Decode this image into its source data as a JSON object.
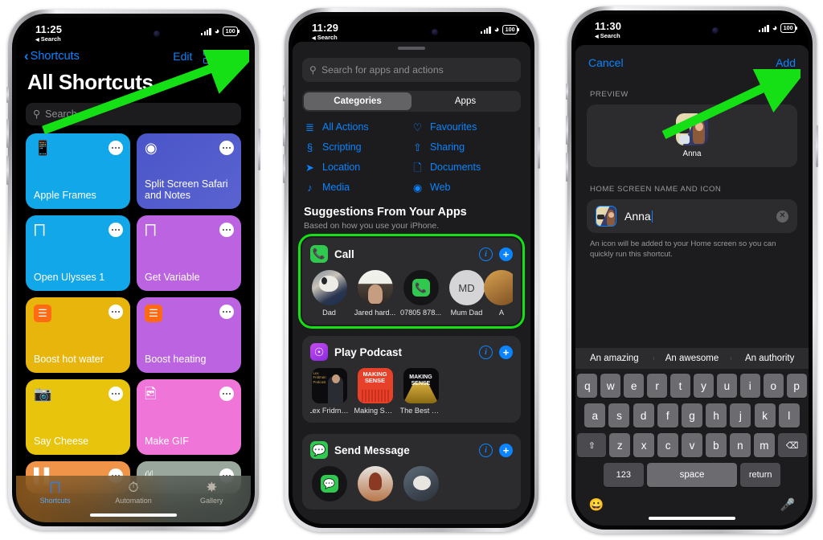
{
  "phones": [
    {
      "id": "shortcuts-list",
      "status": {
        "time": "11:25",
        "back_app": "Search",
        "battery": "100",
        "wifi_icon": "wifi-icon",
        "signal_icon": "cellular-signal-icon"
      },
      "nav": {
        "back_label": "Shortcuts",
        "edit_label": "Edit",
        "grid_icon": "grid-view-icon",
        "add_icon": "plus-icon"
      },
      "title": "All Shortcuts",
      "search": {
        "placeholder": "Search",
        "icon": "search-icon"
      },
      "shortcuts": [
        {
          "name": "Apple Frames",
          "color": "#12a7e8",
          "glyph": "📱",
          "icon_name": "iphone-icon",
          "menu_icon": "ellipsis-icon"
        },
        {
          "name": "Split Screen Safari and Notes",
          "color": "#4a55c8",
          "glyph": "◎",
          "icon_name": "safari-compass-icon",
          "menu_icon": "ellipsis-icon"
        },
        {
          "name": "Open Ulysses 1",
          "color": "#12a7e8",
          "glyph": "≣",
          "icon_name": "layers-icon",
          "menu_icon": "ellipsis-icon"
        },
        {
          "name": "Get Variable",
          "color": "#bb63e0",
          "glyph": "≣",
          "icon_name": "layers-icon",
          "menu_icon": "ellipsis-icon"
        },
        {
          "name": "Boost hot water",
          "color": "#e8b50c",
          "glyph": "☰",
          "icon_name": "home-radiator-icon",
          "menu_icon": "ellipsis-icon"
        },
        {
          "name": "Boost heating",
          "color": "#bb63e0",
          "glyph": "☰",
          "icon_name": "home-radiator-icon",
          "menu_icon": "ellipsis-icon"
        },
        {
          "name": "Say Cheese",
          "color": "#e8c50c",
          "glyph": "📷",
          "icon_name": "camera-icon",
          "menu_icon": "ellipsis-icon"
        },
        {
          "name": "Make GIF",
          "color": "#ef76d8",
          "glyph": "🖼",
          "icon_name": "photos-stack-icon",
          "menu_icon": "ellipsis-icon"
        },
        {
          "name": "",
          "color": "#f0944a",
          "glyph": "▐▌",
          "icon_name": "books-icon",
          "menu_icon": "ellipsis-icon"
        },
        {
          "name": "",
          "color": "#9aa79c",
          "glyph": "⚇",
          "icon_name": "airpods-icon",
          "menu_icon": "ellipsis-icon"
        }
      ],
      "tabs": [
        {
          "label": "Shortcuts",
          "icon_name": "layers-icon",
          "glyph": "≣",
          "active": true
        },
        {
          "label": "Automation",
          "icon_name": "clock-automation-icon",
          "glyph": "⏱",
          "active": false
        },
        {
          "label": "Gallery",
          "icon_name": "gallery-sparkle-icon",
          "glyph": "✨",
          "active": false
        }
      ],
      "annotation": {
        "type": "arrow",
        "color": "#15e015",
        "target": "plus-icon"
      }
    },
    {
      "id": "action-picker",
      "status": {
        "time": "11:29",
        "back_app": "Search",
        "battery": "100",
        "wifi_icon": "wifi-icon",
        "signal_icon": "cellular-signal-icon"
      },
      "search": {
        "placeholder": "Search for apps and actions",
        "icon": "search-icon"
      },
      "segments": [
        {
          "label": "Categories",
          "selected": true
        },
        {
          "label": "Apps",
          "selected": false
        }
      ],
      "categories": [
        {
          "label": "All Actions",
          "icon_name": "list-bullet-icon",
          "glyph": "☰"
        },
        {
          "label": "Favourites",
          "icon_name": "heart-icon",
          "glyph": "♡"
        },
        {
          "label": "Scripting",
          "icon_name": "scripting-icon",
          "glyph": "§"
        },
        {
          "label": "Sharing",
          "icon_name": "share-icon",
          "glyph": "⇧"
        },
        {
          "label": "Location",
          "icon_name": "location-arrow-icon",
          "glyph": "➤"
        },
        {
          "label": "Documents",
          "icon_name": "document-icon",
          "glyph": "☐"
        },
        {
          "label": "Media",
          "icon_name": "music-note-icon",
          "glyph": "♪"
        },
        {
          "label": "Web",
          "icon_name": "safari-compass-icon",
          "glyph": "◎"
        }
      ],
      "suggestions_header": "Suggestions From Your Apps",
      "suggestions_sub": "Based on how you use your iPhone.",
      "suggestions": [
        {
          "title": "Call",
          "app_icon_name": "phone-app-icon",
          "app_glyph": "📞",
          "app_color": "#30c94f",
          "info_icon": "info-icon",
          "add_icon": "plus-circle-icon",
          "highlighted": true,
          "items": [
            {
              "label": "Dad",
              "kind": "photo-dog"
            },
            {
              "label": "Jared hard...",
              "kind": "photo-person"
            },
            {
              "label": "07805 878...",
              "kind": "phone-glyph"
            },
            {
              "label": "Mum Dad",
              "kind": "initials",
              "initials": "MD"
            },
            {
              "label": "A",
              "kind": "photo-cut"
            }
          ]
        },
        {
          "title": "Play Podcast",
          "app_icon_name": "podcasts-app-icon",
          "app_glyph": "ⓟ",
          "app_color": "#9b3ce0",
          "info_icon": "info-icon",
          "add_icon": "plus-circle-icon",
          "highlighted": false,
          "items": [
            {
              "label": "Lex Fridma...",
              "kind": "art-lex"
            },
            {
              "label": "Making Sen...",
              "kind": "art-making-red"
            },
            {
              "label": "The Best of...",
              "kind": "art-making-black"
            }
          ]
        },
        {
          "title": "Send Message",
          "app_icon_name": "messages-app-icon",
          "app_glyph": "💬",
          "app_color": "#30c94f",
          "info_icon": "info-icon",
          "add_icon": "plus-circle-icon",
          "highlighted": false,
          "items": [
            {
              "label": "",
              "kind": "msg-glyph"
            },
            {
              "label": "",
              "kind": "photo-woman"
            },
            {
              "label": "",
              "kind": "photo-dog"
            }
          ]
        }
      ]
    },
    {
      "id": "add-to-home-screen",
      "status": {
        "time": "11:30",
        "back_app": "Search",
        "battery": "100",
        "wifi_icon": "wifi-icon",
        "signal_icon": "cellular-signal-icon"
      },
      "nav": {
        "cancel_label": "Cancel",
        "add_label": "Add"
      },
      "preview_label": "PREVIEW",
      "preview": {
        "app_name": "Anna",
        "icon_name": "anna-photo-icon"
      },
      "field_label": "HOME SCREEN NAME AND ICON",
      "field": {
        "value": "Anna",
        "icon_name": "anna-photo-icon",
        "clear_icon": "clear-x-icon"
      },
      "note": "An icon will be added to your Home screen so you can quickly run this shortcut.",
      "predictions": [
        "An amazing",
        "An awesome",
        "An authority"
      ],
      "keyboard": {
        "row1": [
          "q",
          "w",
          "e",
          "r",
          "t",
          "y",
          "u",
          "i",
          "o",
          "p"
        ],
        "row2": [
          "a",
          "s",
          "d",
          "f",
          "g",
          "h",
          "j",
          "k",
          "l"
        ],
        "row3": [
          "z",
          "x",
          "c",
          "v",
          "b",
          "n",
          "m"
        ],
        "shift_icon": "shift-icon",
        "backspace_icon": "backspace-icon",
        "numbers_label": "123",
        "space_label": "space",
        "return_label": "return",
        "emoji_icon": "emoji-icon",
        "mic_icon": "microphone-icon"
      },
      "annotation": {
        "type": "arrow",
        "color": "#15e015",
        "target": "add-button"
      }
    }
  ],
  "colors": {
    "accent_blue": "#0a84ff",
    "annotation_green": "#15e015",
    "sheet_bg": "#1c1c1e",
    "card_bg": "#2c2c2e"
  }
}
